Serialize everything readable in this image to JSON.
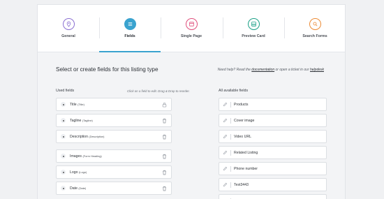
{
  "tabs": [
    {
      "label": "General",
      "icon": "location-pin-icon",
      "color": "#8a6fd1"
    },
    {
      "label": "Fields",
      "icon": "list-icon",
      "color": "#3aa3cf",
      "active": true
    },
    {
      "label": "Single Page",
      "icon": "layout-icon",
      "color": "#e04f7c"
    },
    {
      "label": "Preview Card",
      "icon": "card-icon",
      "color": "#1aa086"
    },
    {
      "label": "Search Forms",
      "icon": "search-icon",
      "color": "#ec8a34"
    }
  ],
  "page": {
    "heading": "Select or create fields for this listing type",
    "help_prefix": "Need help? Read the",
    "help_doc_link": "documentation",
    "help_middle": "or open a ticket in our",
    "help_desk_link": "helpdesk"
  },
  "used_fields": {
    "label": "Used fields",
    "hint": "Click on a field to edit. Drag & Drop to reorder.",
    "items": [
      {
        "name": "Title",
        "key": "(Title)",
        "icon": "lock-icon"
      },
      {
        "name": "Tagline",
        "key": "(Tagline)",
        "icon": "trash-icon"
      },
      {
        "name": "Description",
        "key": "(Description)",
        "icon": "trash-icon"
      },
      {
        "name": "Images",
        "key": "(Form Heading)",
        "icon": "trash-icon"
      },
      {
        "name": "Logo",
        "key": "(Logo)",
        "icon": "trash-icon"
      },
      {
        "name": "Date",
        "key": "(Date)",
        "icon": "trash-icon"
      }
    ]
  },
  "available_fields": {
    "label": "All available fields",
    "items": [
      "Products",
      "Cover image",
      "Video URL",
      "Related Listing",
      "Phone number",
      "Test3443"
    ]
  },
  "colors": {
    "accent": "#3aa3cf"
  }
}
